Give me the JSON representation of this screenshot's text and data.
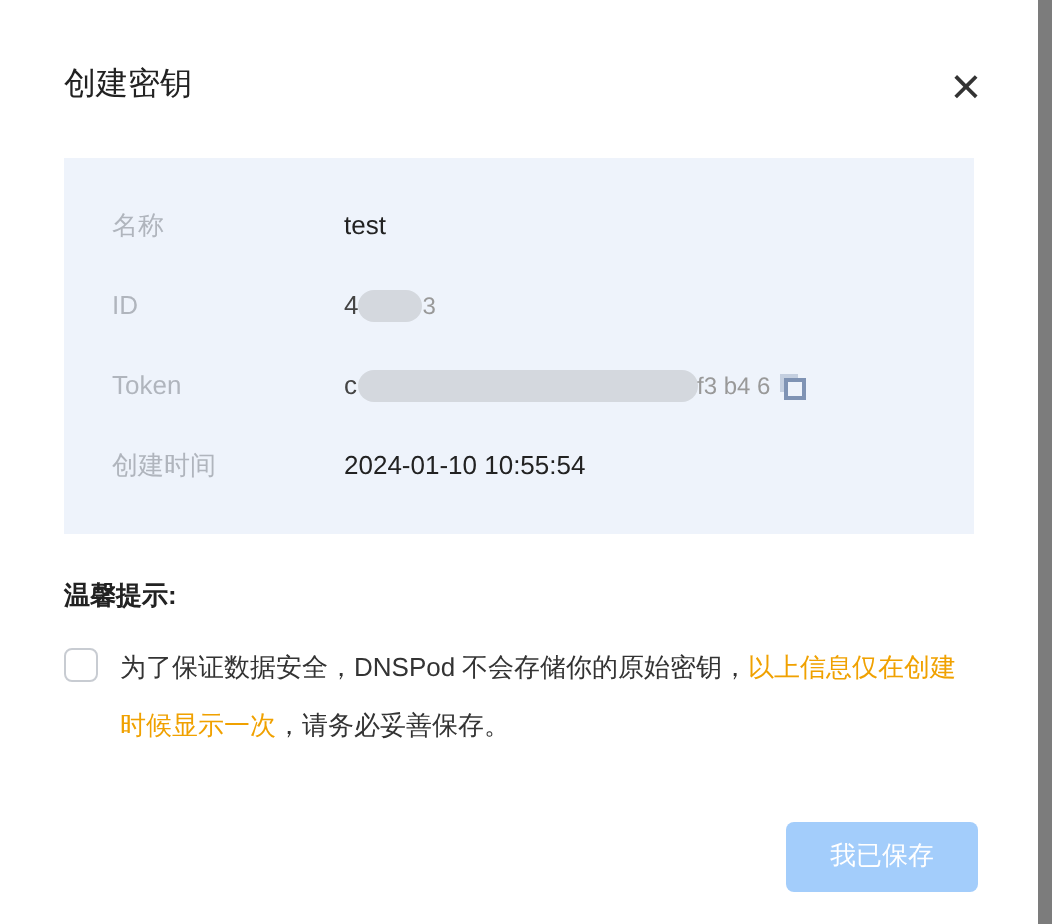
{
  "dialog": {
    "title": "创建密钥",
    "close": "×"
  },
  "fields": [
    {
      "label": "名称",
      "kind": "text",
      "value": "test"
    },
    {
      "label": "ID",
      "kind": "redacted",
      "fragments": [
        "4",
        "3"
      ]
    },
    {
      "label": "Token",
      "kind": "redacted",
      "fragments": [
        "c",
        "f3 b4 6"
      ],
      "copyable": true
    },
    {
      "label": "创建时间",
      "kind": "text",
      "value": "2024-01-10 10:55:54"
    }
  ],
  "tip": {
    "heading": "温馨提示:",
    "checked": false,
    "text": "为了保证数据安全，DNSPod 不会存储你的原始密钥，",
    "highlight": "以上信息仅在创建时候显示一次",
    "tail": "，请务必妥善保存。"
  },
  "confirm": {
    "label": "我已保存",
    "disabled": true
  }
}
